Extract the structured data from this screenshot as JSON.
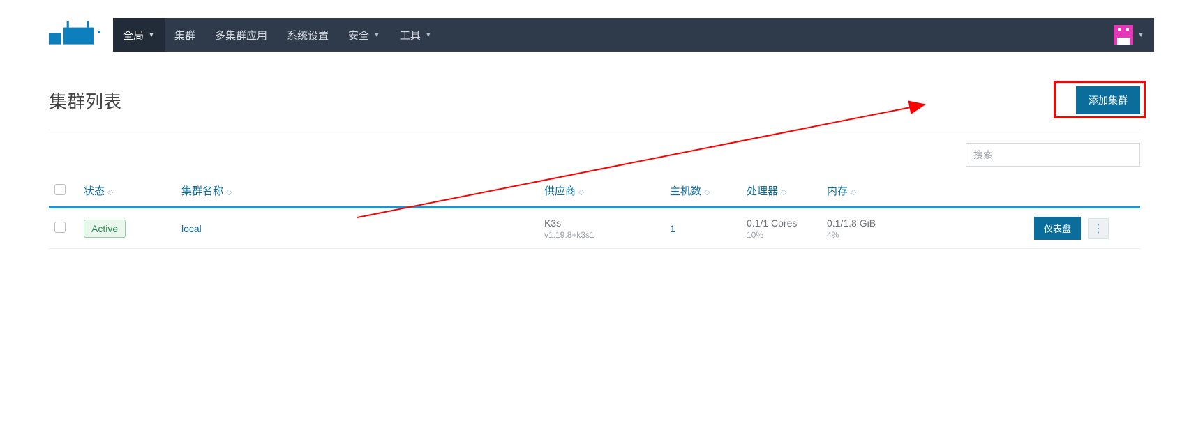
{
  "nav": {
    "items": [
      {
        "label": "全局",
        "active": true,
        "caret": true
      },
      {
        "label": "集群",
        "active": false,
        "caret": false
      },
      {
        "label": "多集群应用",
        "active": false,
        "caret": false
      },
      {
        "label": "系统设置",
        "active": false,
        "caret": false
      },
      {
        "label": "安全",
        "active": false,
        "caret": true
      },
      {
        "label": "工具",
        "active": false,
        "caret": true
      }
    ]
  },
  "page": {
    "title": "集群列表",
    "add_button": "添加集群",
    "search_placeholder": "搜索"
  },
  "columns": {
    "state": "状态",
    "name": "集群名称",
    "provider": "供应商",
    "nodes": "主机数",
    "cpu": "处理器",
    "mem": "内存"
  },
  "rows": [
    {
      "state_label": "Active",
      "name": "local",
      "provider": "K3s",
      "provider_version": "v1.19.8+k3s1",
      "nodes": "1",
      "cpu": "0.1/1 Cores",
      "cpu_pct": "10%",
      "mem": "0.1/1.8 GiB",
      "mem_pct": "4%",
      "dashboard_label": "仪表盘"
    }
  ]
}
